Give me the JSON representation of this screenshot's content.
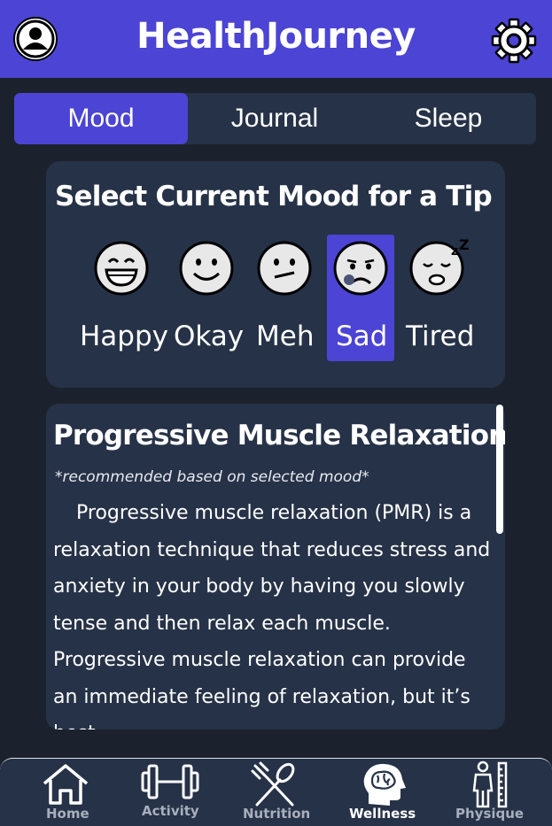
{
  "header": {
    "title": "HealthJourney",
    "profile_icon": "profile-avatar-icon",
    "settings_icon": "gear-icon",
    "accent_color": "#4b44d4"
  },
  "tabs": [
    {
      "label": "Mood",
      "active": true
    },
    {
      "label": "Journal",
      "active": false
    },
    {
      "label": "Sleep",
      "active": false
    }
  ],
  "mood": {
    "heading": "Select Current Mood for a Tip",
    "options": [
      {
        "label": "Happy",
        "icon": "grinning-face-icon",
        "selected": false
      },
      {
        "label": "Okay",
        "icon": "smiling-face-icon",
        "selected": false
      },
      {
        "label": "Meh",
        "icon": "neutral-face-icon",
        "selected": false
      },
      {
        "label": "Sad",
        "icon": "sad-face-icon",
        "selected": true
      },
      {
        "label": "Tired",
        "icon": "sleeping-face-icon",
        "selected": false
      }
    ]
  },
  "tip": {
    "title": "Progressive Muscle Relaxation",
    "subtitle": "*recommended based on selected mood*",
    "paragraph1": "Progressive muscle relaxation (PMR) is a relaxation technique that reduces stress and anxiety in your body by having you slowly tense and then relax each muscle.",
    "paragraph2": "Progressive muscle relaxation can provide an immediate feeling of relaxation, but it’s best"
  },
  "nav": [
    {
      "label": "Home",
      "icon": "home-icon",
      "active": false
    },
    {
      "label": "Activity",
      "icon": "dumbbell-icon",
      "active": false
    },
    {
      "label": "Nutrition",
      "icon": "fork-spoon-icon",
      "active": false
    },
    {
      "label": "Wellness",
      "icon": "brain-head-icon",
      "active": true
    },
    {
      "label": "Physique",
      "icon": "body-measure-icon",
      "active": false
    }
  ]
}
